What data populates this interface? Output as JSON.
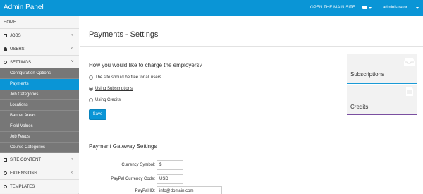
{
  "topbar": {
    "title": "Admin Panel",
    "open_site": "OPEN THE MAIN SITE",
    "user": "administrator"
  },
  "sidebar": {
    "items": [
      {
        "label": "HOME"
      },
      {
        "label": "JOBS"
      },
      {
        "label": "USERS"
      },
      {
        "label": "SETTINGS"
      }
    ],
    "settings_sub": [
      {
        "label": "Configuration Options"
      },
      {
        "label": "Payments"
      },
      {
        "label": "Job Categories"
      },
      {
        "label": "Locations"
      },
      {
        "label": "Banner Areas"
      },
      {
        "label": "Field Values"
      },
      {
        "label": "Job Feeds"
      },
      {
        "label": "Course Categories"
      }
    ],
    "items_after": [
      {
        "label": "SITE CONTENT"
      },
      {
        "label": "EXTENSIONS"
      },
      {
        "label": "TEMPLATES"
      }
    ]
  },
  "main": {
    "title": "Payments - Settings",
    "question": "How you would like to charge the employers?",
    "options": [
      {
        "label": "The site should be free for all users.",
        "checked": false
      },
      {
        "label": "Using Subscriptions",
        "checked": true
      },
      {
        "label": "Using Credits",
        "checked": false
      }
    ],
    "save_label": "Save",
    "gateway_heading": "Payment Gateway Settings",
    "fields": [
      {
        "label": "Currency Symbol:",
        "value": "$"
      },
      {
        "label": "PayPal Currency Code:",
        "value": "USD"
      },
      {
        "label": "PayPal ID:",
        "value": "info@domain.com"
      }
    ]
  },
  "cards": [
    {
      "label": "Subscriptions",
      "accent": "#1a9ad6",
      "icon": "inbox-icon"
    },
    {
      "label": "Credits",
      "accent": "#7a4fa0",
      "icon": "document-icon"
    }
  ],
  "colors": {
    "primary": "#0a95d6",
    "sidebar_sub": "#777777"
  }
}
